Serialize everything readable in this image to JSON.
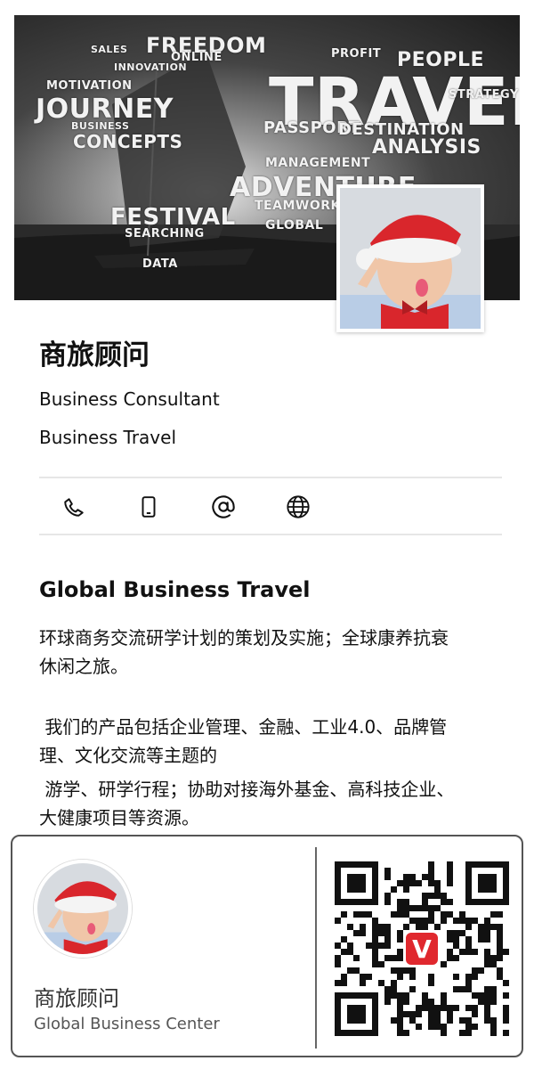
{
  "banner": {
    "words": [
      "TRAVEL",
      "FREEDOM",
      "JOURNEY",
      "CONCEPTS",
      "FESTIVAL",
      "ADVENTURE",
      "PEOPLE",
      "ANALYSIS",
      "PASSPORT",
      "DESTINATION",
      "MANAGEMENT",
      "STRATEGY",
      "TEAMWORK",
      "GLOBAL",
      "MOTIVATION",
      "ONLINE",
      "DATA",
      "PROFIT",
      "SALES",
      "INNOVATION",
      "SEARCHING",
      "BUSINESS"
    ]
  },
  "profile": {
    "name": "商旅顾问",
    "line1": "Business Consultant",
    "line2": "Business Travel"
  },
  "contact_icons": [
    "phone-icon",
    "mobile-icon",
    "email-icon",
    "globe-icon"
  ],
  "about": {
    "title": "Global Business Travel",
    "para1_line1": "环球商务交流研学计划的策划及实施；全球康养抗衰",
    "para1_line2": "休闲之旅。",
    "para2_line1": " 我们的产品包括企业管理、金融、工业4.0、品牌管",
    "para2_line2": "理、文化交流等主题的",
    "para2_line3": " 游学、研学行程；协助对接海外基金、高科技企业、",
    "para2_line4": "大健康项目等资源。"
  },
  "card": {
    "name": "商旅顾问",
    "subtitle": "Global Business Center",
    "qr_badge_letter": "V",
    "qr_badge_color": "#e0282e"
  },
  "colors": {
    "text": "#111111",
    "divider": "#e6e6e6",
    "accent_red": "#d9262c"
  }
}
